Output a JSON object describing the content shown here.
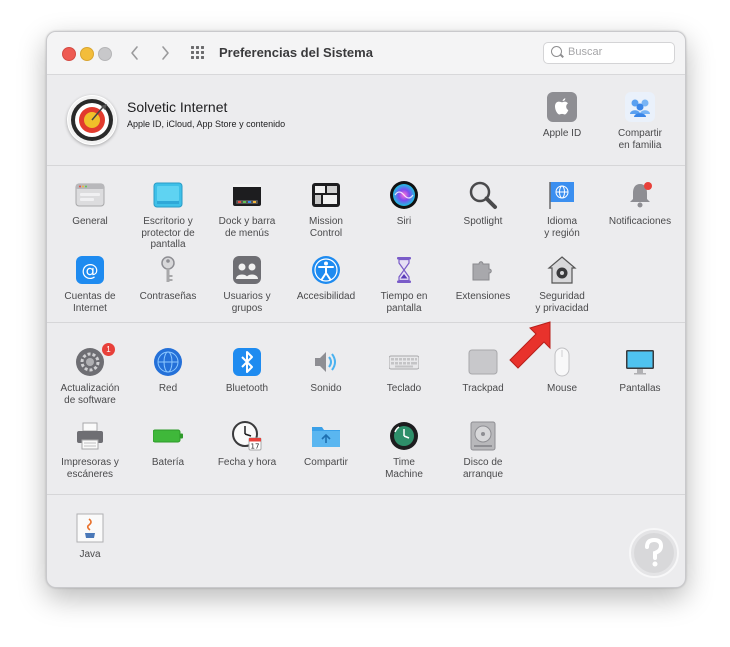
{
  "window": {
    "title": "Preferencias del Sistema",
    "search_placeholder": "Buscar"
  },
  "account": {
    "name": "Solvetic Internet",
    "subtitle": "Apple ID, iCloud, App Store y contenido",
    "apple_id_label": "Apple ID",
    "family_label": "Compartir\nen familia"
  },
  "sections": {
    "personal_row1": [
      {
        "id": "general",
        "label": "General",
        "icon": "general-icon"
      },
      {
        "id": "desktop",
        "label": "Escritorio y\nprotector de pantalla",
        "icon": "desktop-icon"
      },
      {
        "id": "dock",
        "label": "Dock y barra\nde menús",
        "icon": "dock-icon"
      },
      {
        "id": "mission",
        "label": "Mission\nControl",
        "icon": "mission-control-icon"
      },
      {
        "id": "siri",
        "label": "Siri",
        "icon": "siri-icon"
      },
      {
        "id": "spotlight",
        "label": "Spotlight",
        "icon": "spotlight-icon"
      },
      {
        "id": "language",
        "label": "Idioma\ny región",
        "icon": "globe-flag-icon"
      },
      {
        "id": "notifications",
        "label": "Notificaciones",
        "icon": "bell-icon"
      }
    ],
    "personal_row2": [
      {
        "id": "internet_accounts",
        "label": "Cuentas de\nInternet",
        "icon": "at-icon"
      },
      {
        "id": "passwords",
        "label": "Contraseñas",
        "icon": "key-icon"
      },
      {
        "id": "users",
        "label": "Usuarios y\ngrupos",
        "icon": "users-icon"
      },
      {
        "id": "accessibility",
        "label": "Accesibilidad",
        "icon": "accessibility-icon"
      },
      {
        "id": "screentime",
        "label": "Tiempo en\npantalla",
        "icon": "hourglass-icon"
      },
      {
        "id": "extensions",
        "label": "Extensiones",
        "icon": "puzzle-icon"
      },
      {
        "id": "security",
        "label": "Seguridad\ny privacidad",
        "icon": "house-lock-icon"
      }
    ],
    "hardware_row1": [
      {
        "id": "software_update",
        "label": "Actualización\nde software",
        "icon": "gear-update-icon",
        "badge": "1"
      },
      {
        "id": "network",
        "label": "Red",
        "icon": "network-globe-icon"
      },
      {
        "id": "bluetooth",
        "label": "Bluetooth",
        "icon": "bluetooth-icon"
      },
      {
        "id": "sound",
        "label": "Sonido",
        "icon": "speaker-icon"
      },
      {
        "id": "keyboard",
        "label": "Teclado",
        "icon": "keyboard-icon"
      },
      {
        "id": "trackpad",
        "label": "Trackpad",
        "icon": "trackpad-icon"
      },
      {
        "id": "mouse",
        "label": "Mouse",
        "icon": "mouse-icon"
      },
      {
        "id": "displays",
        "label": "Pantallas",
        "icon": "display-icon"
      }
    ],
    "hardware_row2": [
      {
        "id": "printers",
        "label": "Impresoras y\nescáneres",
        "icon": "printer-icon"
      },
      {
        "id": "battery",
        "label": "Batería",
        "icon": "battery-icon"
      },
      {
        "id": "datetime",
        "label": "Fecha y hora",
        "icon": "clock-calendar-icon",
        "calendar_day": "17"
      },
      {
        "id": "sharing",
        "label": "Compartir",
        "icon": "sharing-folder-icon"
      },
      {
        "id": "timemachine",
        "label": "Time\nMachine",
        "icon": "time-machine-icon"
      },
      {
        "id": "startup",
        "label": "Disco de\narranque",
        "icon": "hard-disk-icon"
      }
    ],
    "other": [
      {
        "id": "java",
        "label": "Java",
        "icon": "java-icon"
      }
    ]
  },
  "colors": {
    "accent_blue": "#1e8bf0",
    "red_badge": "#e8403a",
    "arrow_red": "#e8322c"
  }
}
